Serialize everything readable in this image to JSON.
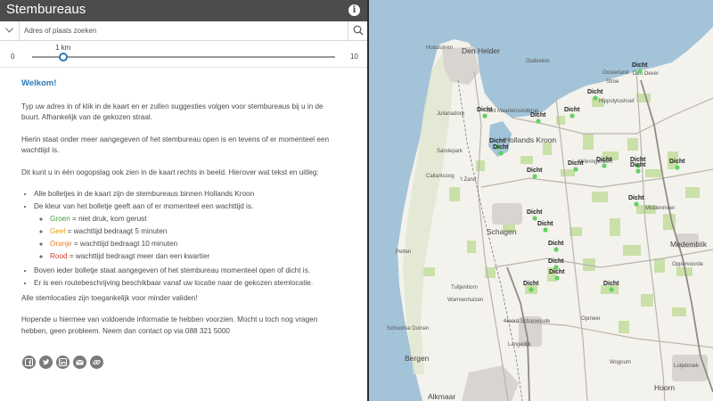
{
  "app": {
    "title": "Stembureaus",
    "info_icon": "info-icon"
  },
  "search": {
    "placeholder": "Adres of plaats zoeken",
    "value": ""
  },
  "distance_slider": {
    "value_label": "1 km",
    "min_label": "0",
    "max_label": "10",
    "value": 1
  },
  "content": {
    "welcome": "Welkom!",
    "paragraphs": [
      "Typ uw adres in of klik in de kaart en er zullen suggesties volgen voor stembureaus bij u in de buurt. Afhankelijk van de gekozen straal.",
      "Hierin staat onder meer aangegeven of het stembureau open is en tevens of er momenteel een wachttijd is.",
      "Dit kunt u in één oogopslag ook zien in de kaart rechts in beeld. Hierover wat tekst en uitleg:"
    ],
    "bullets": [
      "Alle bolletjes in de kaart zijn de stembureaus binnen Hollands Kroon",
      "De kleur van het bolletje geeft aan of er momenteel een wachttijd is."
    ],
    "legend": [
      {
        "color_word": "Groen",
        "text": " = niet druk, kom gerust",
        "color": "#3f9b3f"
      },
      {
        "color_word": "Geel",
        "text": " = wachttijd bedraagt 5 minuten",
        "color": "#e1a31a"
      },
      {
        "color_word": "Oranje",
        "text": " = wachttijd bedraagt 10 minuten",
        "color": "#ee7d2a"
      },
      {
        "color_word": "Rood",
        "text": " = wachttijd bedraagt meer dan een kwartier",
        "color": "#d23c2f"
      }
    ],
    "bullets_after": [
      "Boven ieder bolletje staat aangegeven of het stembureau momenteel open of dicht is.",
      "Er is een routebeschrijving beschikbaar vanaf uw locatie naar de gekozen stemlocatie."
    ],
    "accessibility": "Alle stemlocaties zijn toegankelijk voor minder validen!",
    "closing": "Hopende u hiermee van voldoende informatie te hebben voorzien. Mocht u toch nog vragen hebben, geen probleem. Neem dan contact op via 088 321 5000"
  },
  "share_icons": [
    "facebook-icon",
    "twitter-icon",
    "linkedin-icon",
    "email-icon",
    "link-icon"
  ],
  "map": {
    "marker_label": "Dicht",
    "marker_color": "#5fd35f",
    "places": [
      "Den Helder",
      "Huisduinen",
      "Julianadorp",
      "Oosterland",
      "Stroe",
      "Hippolytushoef",
      "Hollands Kroon",
      "Sint Maartensvlotbrug",
      "Sandepark",
      "Callantsoog",
      "'t Zand",
      "Middenmeer",
      "Wieringerwerf",
      "Schagen",
      "Petten",
      "Tuitjenhorn",
      "Warmenhuizen",
      "Noord Scharwoude",
      "Langedijk",
      "Schoorlse Duinen",
      "Bergen",
      "Alkmaar",
      "Opmeer",
      "Medemblik",
      "Hoorn",
      "Oudesluis",
      "Den Oever",
      "Oppervoorde",
      "Wognum",
      "Lutjebroek"
    ],
    "roads": [
      "A7",
      "N248"
    ]
  },
  "colors": {
    "header": "#4c4c4c",
    "accent": "#2a7ab8",
    "water": "#a3c3d8",
    "land": "#f4f2ec",
    "green": "#c9e0a8",
    "urban": "#d8d5d0"
  }
}
